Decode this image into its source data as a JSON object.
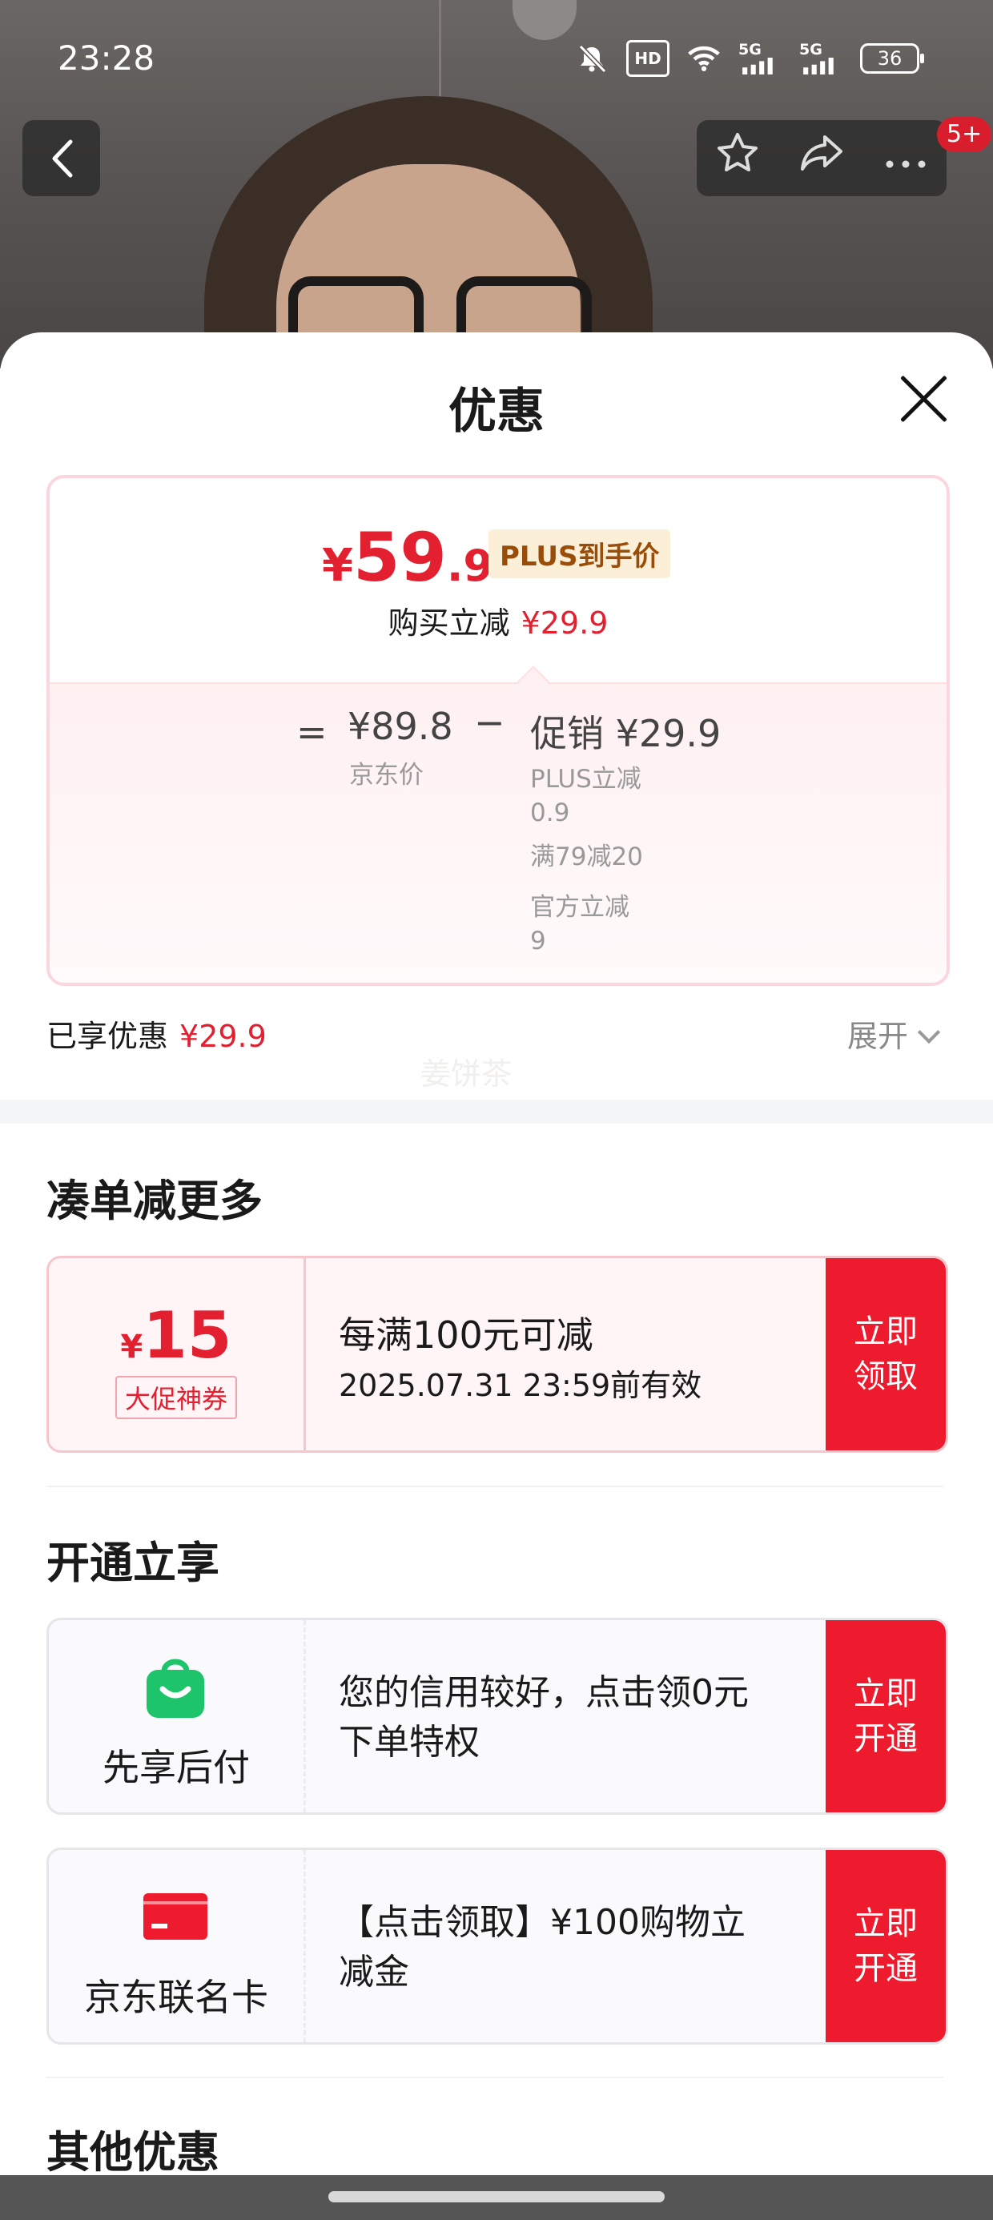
{
  "status_bar": {
    "time": "23:28",
    "hd_label": "HD",
    "signal_1": "5G",
    "signal_2": "5G",
    "battery": "36"
  },
  "nav": {
    "badge": "5+"
  },
  "sheet": {
    "title": "优惠"
  },
  "price_card": {
    "currency": "¥",
    "final_int": "59",
    "final_dec": ".9",
    "plus_tag": "PLUS到手价",
    "buy_minus_label": "购买立减",
    "buy_minus_value": "¥29.9",
    "equals": "=",
    "jd_price": "¥89.8",
    "jd_label": "京东价",
    "minus": "−",
    "promo": "促销 ¥29.9",
    "promo_items": [
      "PLUS立减",
      "0.9",
      "满79减20",
      "官方立减",
      "9"
    ]
  },
  "enjoyed": {
    "label": "已享优惠",
    "value": "¥29.9",
    "expand": "展开",
    "ghost_text": "姜饼茶"
  },
  "section_more": {
    "title": "凑单减更多",
    "coupon": {
      "currency": "¥",
      "amount": "15",
      "tag": "大促神券",
      "rule": "每满100元可减",
      "valid": "2025.07.31 23:59前有效",
      "action_line1": "立即",
      "action_line2": "领取"
    }
  },
  "section_open": {
    "title": "开通立享",
    "cards": [
      {
        "label": "先享后付",
        "desc_line1": "您的信用较好，点击领0元",
        "desc_line2": "下单特权",
        "action_line1": "立即",
        "action_line2": "开通",
        "icon": "shopping-bag-icon",
        "color": "#1dc46a"
      },
      {
        "label": "京东联名卡",
        "desc_line1": "【点击领取】¥100购物立",
        "desc_line2": "减金",
        "action_line1": "立即",
        "action_line2": "开通",
        "icon": "credit-card-icon",
        "color": "#ee1b2e"
      }
    ]
  },
  "section_other": {
    "title": "其他优惠"
  },
  "colors": {
    "accent": "#e2202f",
    "action_bg": "#ee1b2e",
    "plus_bg": "#fcefd8"
  }
}
